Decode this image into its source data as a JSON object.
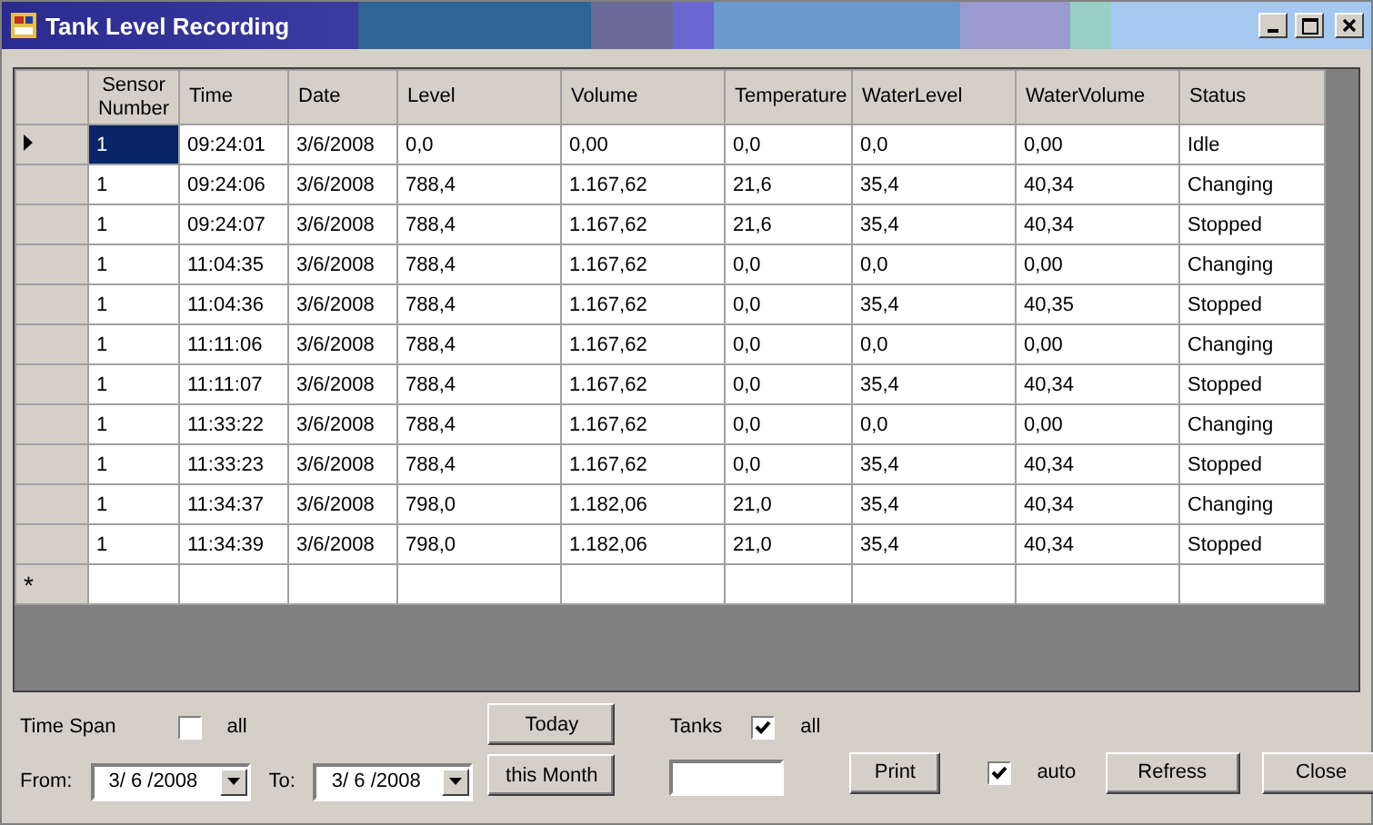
{
  "window": {
    "title": "Tank Level Recording"
  },
  "grid": {
    "columns": [
      "Sensor Number",
      "Time",
      "Date",
      "Level",
      "Volume",
      "Temperature",
      "WaterLevel",
      "WaterVolume",
      "Status"
    ],
    "rows": [
      {
        "selected": true,
        "cells": [
          "1",
          "09:24:01",
          "3/6/2008",
          "0,0",
          "0,00",
          "0,0",
          "0,0",
          "0,00",
          "Idle"
        ]
      },
      {
        "selected": false,
        "cells": [
          "1",
          "09:24:06",
          "3/6/2008",
          "788,4",
          "1.167,62",
          "21,6",
          "35,4",
          "40,34",
          "Changing"
        ]
      },
      {
        "selected": false,
        "cells": [
          "1",
          "09:24:07",
          "3/6/2008",
          "788,4",
          "1.167,62",
          "21,6",
          "35,4",
          "40,34",
          "Stopped"
        ]
      },
      {
        "selected": false,
        "cells": [
          "1",
          "11:04:35",
          "3/6/2008",
          "788,4",
          "1.167,62",
          "0,0",
          "0,0",
          "0,00",
          "Changing"
        ]
      },
      {
        "selected": false,
        "cells": [
          "1",
          "11:04:36",
          "3/6/2008",
          "788,4",
          "1.167,62",
          "0,0",
          "35,4",
          "40,35",
          "Stopped"
        ]
      },
      {
        "selected": false,
        "cells": [
          "1",
          "11:11:06",
          "3/6/2008",
          "788,4",
          "1.167,62",
          "0,0",
          "0,0",
          "0,00",
          "Changing"
        ]
      },
      {
        "selected": false,
        "cells": [
          "1",
          "11:11:07",
          "3/6/2008",
          "788,4",
          "1.167,62",
          "0,0",
          "35,4",
          "40,34",
          "Stopped"
        ]
      },
      {
        "selected": false,
        "cells": [
          "1",
          "11:33:22",
          "3/6/2008",
          "788,4",
          "1.167,62",
          "0,0",
          "0,0",
          "0,00",
          "Changing"
        ]
      },
      {
        "selected": false,
        "cells": [
          "1",
          "11:33:23",
          "3/6/2008",
          "788,4",
          "1.167,62",
          "0,0",
          "35,4",
          "40,34",
          "Stopped"
        ]
      },
      {
        "selected": false,
        "cells": [
          "1",
          "11:34:37",
          "3/6/2008",
          "798,0",
          "1.182,06",
          "21,0",
          "35,4",
          "40,34",
          "Changing"
        ]
      },
      {
        "selected": false,
        "cells": [
          "1",
          "11:34:39",
          "3/6/2008",
          "798,0",
          "1.182,06",
          "21,0",
          "35,4",
          "40,34",
          "Stopped"
        ]
      }
    ],
    "new_row_marker": "*"
  },
  "time_span": {
    "label": "Time Span",
    "all": {
      "label": "all",
      "checked": false
    },
    "from": {
      "label": "From:",
      "value": "3/ 6 /2008"
    },
    "to": {
      "label": "To:",
      "value": "3/ 6 /2008"
    }
  },
  "period_buttons": [
    "Today",
    "this Month"
  ],
  "tanks": {
    "label": "Tanks",
    "all": {
      "label": "all",
      "checked": true
    }
  },
  "print_button": "Print",
  "auto": {
    "label": "auto",
    "checked": true
  },
  "action_buttons": [
    "Refress",
    "Close"
  ]
}
